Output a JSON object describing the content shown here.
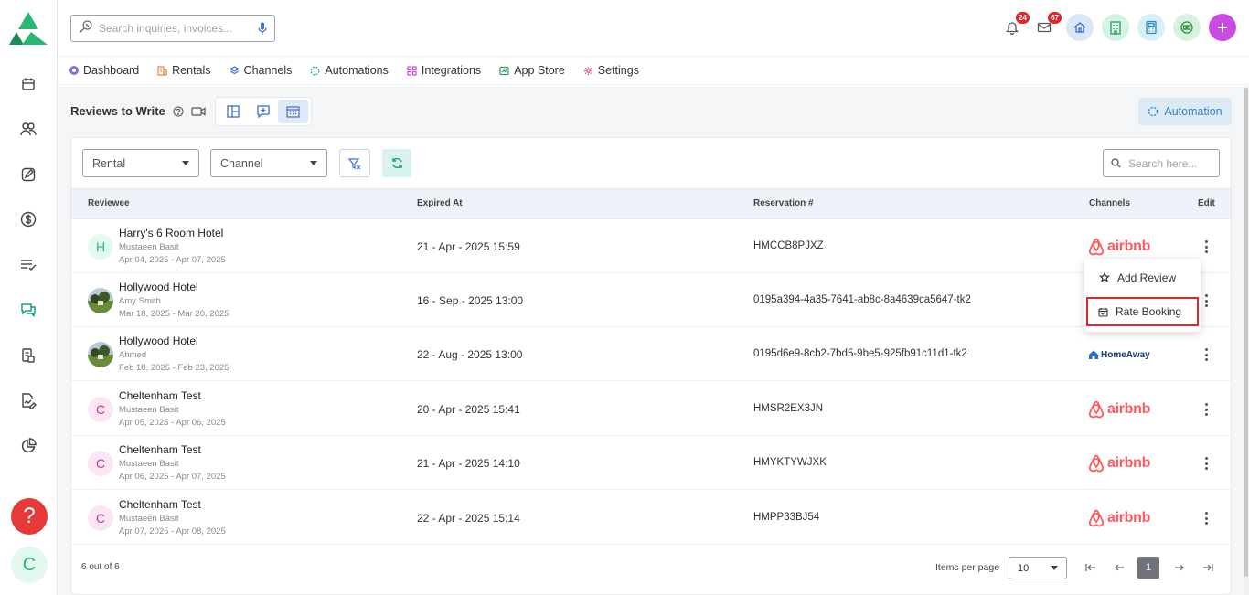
{
  "search": {
    "placeholder": "Search inquiries, invoices..."
  },
  "notifications": {
    "bell_count": "24",
    "mail_count": "67"
  },
  "nav": [
    {
      "label": "Dashboard"
    },
    {
      "label": "Rentals"
    },
    {
      "label": "Channels"
    },
    {
      "label": "Automations"
    },
    {
      "label": "Integrations"
    },
    {
      "label": "App Store"
    },
    {
      "label": "Settings"
    }
  ],
  "page": {
    "title": "Reviews to Write",
    "automation_label": "Automation"
  },
  "filters": {
    "rental": "Rental",
    "channel": "Channel",
    "search_placeholder": "Search here..."
  },
  "table": {
    "headers": {
      "reviewee": "Reviewee",
      "expired": "Expired At",
      "reservation": "Reservation #",
      "channels": "Channels",
      "edit": "Edit"
    },
    "rows": [
      {
        "initial": "H",
        "name": "Harry's 6 Room Hotel",
        "guest": "Mustaeen Basit",
        "dates": "Apr 04, 2025 - Apr 07, 2025",
        "expired": "21 - Apr - 2025 15:59",
        "reservation": "HMCCB8PJXZ",
        "channel": "airbnb"
      },
      {
        "initial": "",
        "name": "Hollywood Hotel",
        "guest": "Amy Smith",
        "dates": "Mar 18, 2025 - Mar 20, 2025",
        "expired": "16 - Sep - 2025 13:00",
        "reservation": "0195a394-4a35-7641-ab8c-8a4639ca5647-tk2",
        "channel": ""
      },
      {
        "initial": "",
        "name": "Hollywood Hotel",
        "guest": "Ahmed",
        "dates": "Feb 18, 2025 - Feb 23, 2025",
        "expired": "22 - Aug - 2025 13:00",
        "reservation": "0195d6e9-8cb2-7bd5-9be5-925fb91c11d1-tk2",
        "channel": "HomeAway"
      },
      {
        "initial": "C",
        "name": "Cheltenham Test",
        "guest": "Mustaeen Basit",
        "dates": "Apr 05, 2025 - Apr 06, 2025",
        "expired": "20 - Apr - 2025 15:41",
        "reservation": "HMSR2EX3JN",
        "channel": "airbnb"
      },
      {
        "initial": "C",
        "name": "Cheltenham Test",
        "guest": "Mustaeen Basit",
        "dates": "Apr 06, 2025 - Apr 07, 2025",
        "expired": "21 - Apr - 2025 14:10",
        "reservation": "HMYKTYWJXK",
        "channel": "airbnb"
      },
      {
        "initial": "C",
        "name": "Cheltenham Test",
        "guest": "Mustaeen Basit",
        "dates": "Apr 07, 2025 - Apr 08, 2025",
        "expired": "22 - Apr - 2025 15:14",
        "reservation": "HMPP33BJ54",
        "channel": "airbnb"
      }
    ]
  },
  "menu": {
    "add_review": "Add Review",
    "rate_booking": "Rate Booking"
  },
  "footer": {
    "count": "6 out of 6",
    "items_per_page_label": "Items per page",
    "items_per_page": "10",
    "current_page": "1"
  },
  "rail": {
    "help": "?",
    "user_initial": "C"
  },
  "colors": {
    "accent": "#3b7fc4",
    "airbnb": "#ff5a5f",
    "danger": "#e0262b",
    "green": "#2bb673"
  }
}
